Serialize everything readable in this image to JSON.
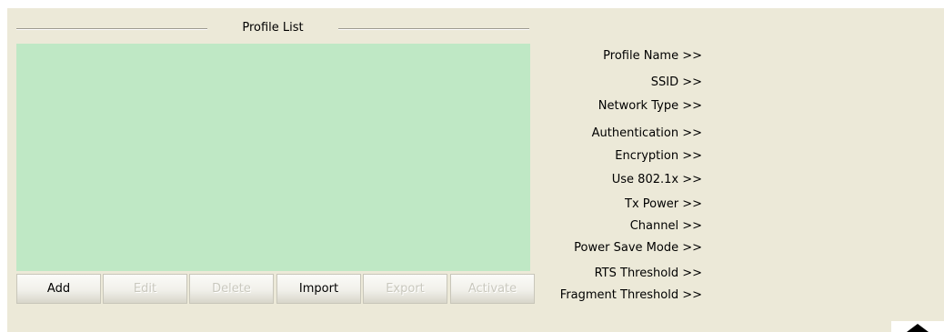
{
  "profile_list": {
    "title": "Profile List",
    "items": []
  },
  "buttons": [
    {
      "label": "Add",
      "enabled": true
    },
    {
      "label": "Edit",
      "enabled": false
    },
    {
      "label": "Delete",
      "enabled": false
    },
    {
      "label": "Import",
      "enabled": true
    },
    {
      "label": "Export",
      "enabled": false
    },
    {
      "label": "Activate",
      "enabled": false
    }
  ],
  "details": {
    "profile_name": "Profile Name >>",
    "ssid": "SSID >>",
    "network_type": "Network Type >>",
    "authentication": "Authentication >>",
    "encryption": "Encryption >>",
    "use_8021x": "Use 802.1x >>",
    "tx_power": "Tx Power >>",
    "channel": "Channel >>",
    "power_save_mode": "Power Save Mode >>",
    "rts_threshold": "RTS Threshold >>",
    "fragment_threshold": "Fragment Threshold >>"
  },
  "colors": {
    "panel_background": "#ece9d8",
    "list_background": "#bfe8c5",
    "disabled_text": "#c9c8be"
  },
  "icons": {
    "collapse": "triangle-up-icon"
  }
}
